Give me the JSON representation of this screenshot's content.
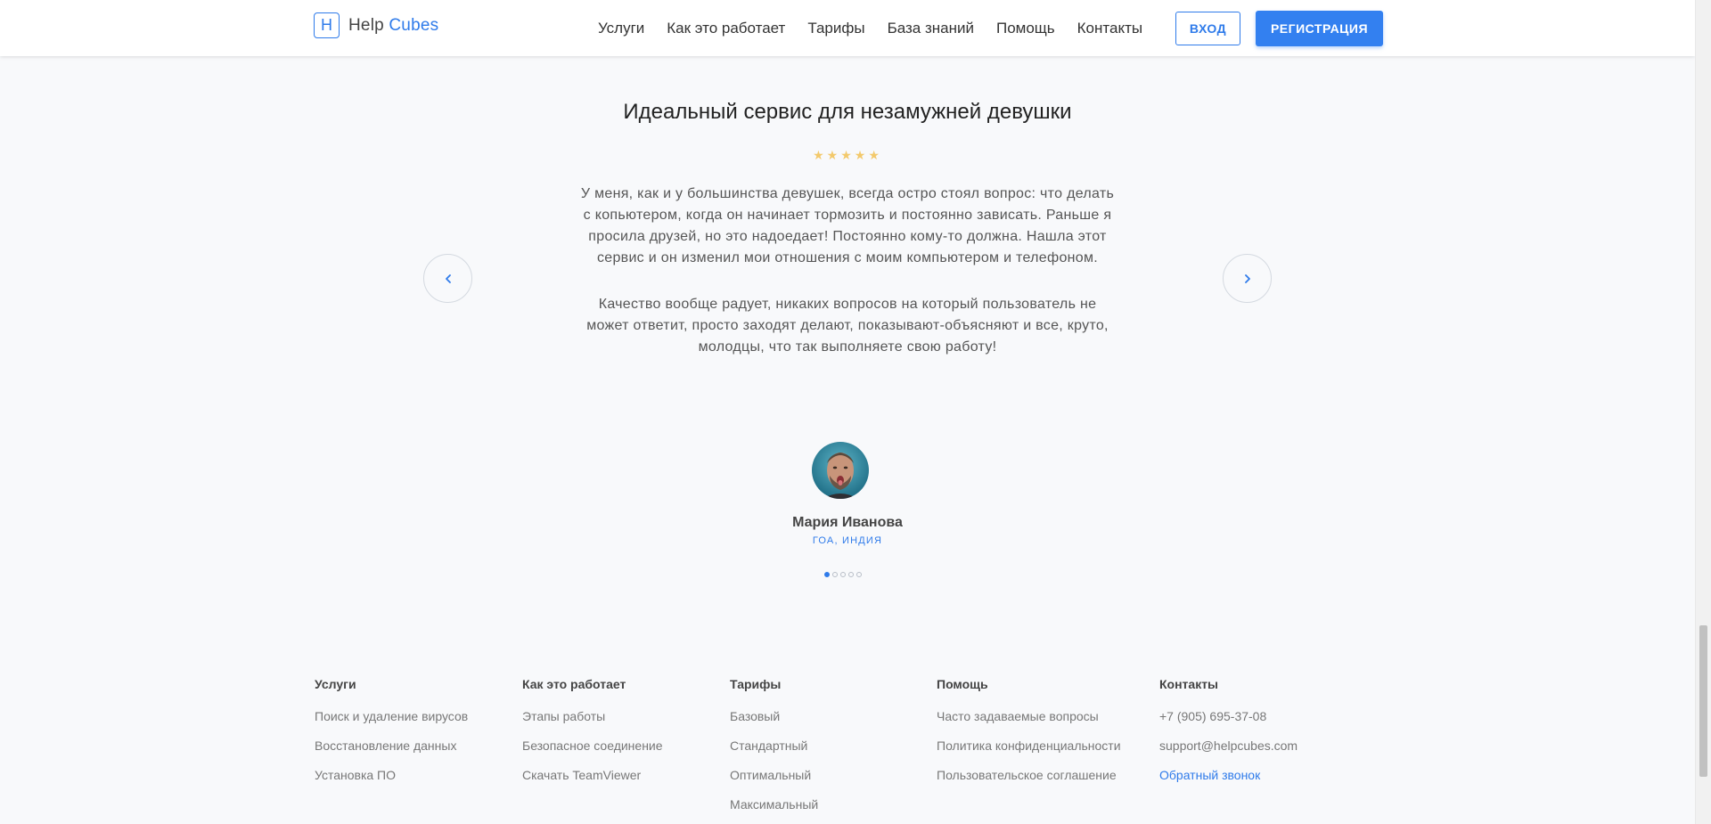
{
  "header": {
    "logo_letter": "H",
    "logo_name_1": "Help",
    "logo_name_2": "Cubes",
    "nav": [
      "Услуги",
      "Как это работает",
      "Тарифы",
      "База знаний",
      "Помощь",
      "Контакты"
    ],
    "login_label": "ВХОД",
    "register_label": "РЕГИСТРАЦИЯ"
  },
  "testimonial": {
    "title": "Идеальный сервис для незамужней девушки",
    "stars": "★★★★★",
    "rating": 5,
    "paragraphs": [
      "У меня, как и у большинства девушек, всегда остро стоял вопрос: что делать с копьютером, когда он начинает тормозить и постоянно зависать. Раньше я просила друзей, но это надоедает! Постоянно кому-то должна. Нашла этот сервис и он изменил мои отношения с моим компьютером и телефоном.",
      "Качество вообще радует, никаких вопросов на который пользователь не может ответит, просто заходят делают, показывают-объясняют и все, круто, молодцы, что так выполняете свою работу!"
    ],
    "author_name": "Мария Иванова",
    "author_location": "Гоа, Индия",
    "slides_total": 5,
    "active_slide": 1
  },
  "footer": {
    "columns": [
      {
        "heading": "Услуги",
        "links": [
          "Поиск и удаление вирусов",
          "Восстановление данных",
          "Установка ПО"
        ]
      },
      {
        "heading": "Как это работает",
        "links": [
          "Этапы работы",
          "Безопасное соединение",
          "Скачать TeamViewer"
        ]
      },
      {
        "heading": "Тарифы",
        "links": [
          "Базовый",
          "Стандартный",
          "Оптимальный",
          "Максимальный"
        ]
      },
      {
        "heading": "Помощь",
        "links": [
          "Часто задаваемые вопросы",
          "Политика конфиденциальности",
          "Пользовательское соглашение"
        ]
      },
      {
        "heading": "Контакты",
        "links": [
          "+7 (905) 695-37-08",
          "support@helpcubes.com",
          "Обратный звонок"
        ]
      }
    ]
  },
  "colors": {
    "accent": "#2f7bea",
    "star": "#f3c96b",
    "background": "#f8f9fb"
  },
  "icons": {
    "prev": "chevron-left-icon",
    "next": "chevron-right-icon"
  }
}
